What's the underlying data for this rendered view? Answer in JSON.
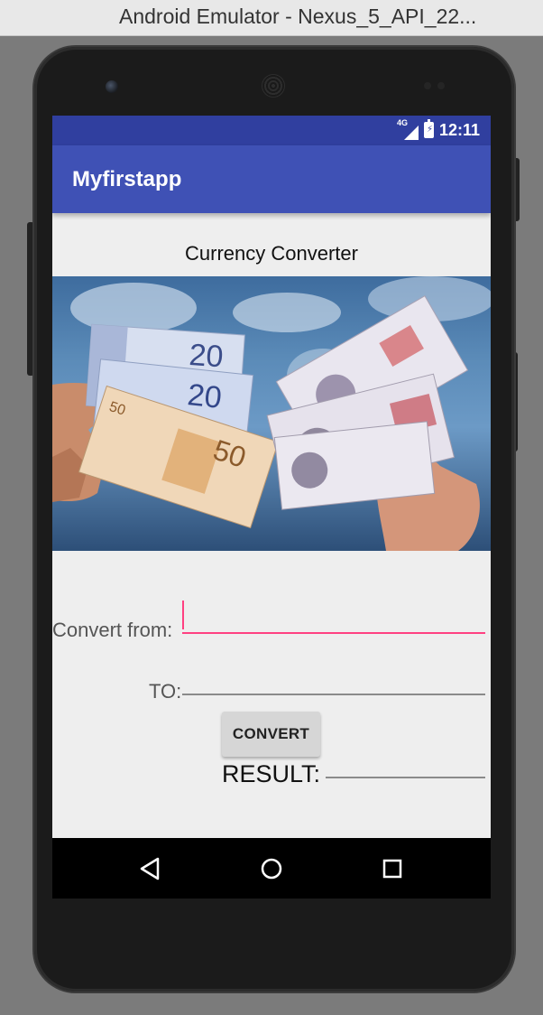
{
  "window": {
    "title": "Android Emulator - Nexus_5_API_22..."
  },
  "status_bar": {
    "network": "4G",
    "time": "12:11"
  },
  "app_bar": {
    "title": "Myfirstapp"
  },
  "main": {
    "heading": "Currency Converter",
    "convert_from_label": "Convert from:",
    "convert_from_value": "",
    "to_label": "TO:",
    "to_value": "",
    "convert_button": "CONVERT",
    "result_label": "RESULT:",
    "result_value": ""
  },
  "nav_bar": {
    "icons": [
      "back-icon",
      "home-icon",
      "recents-icon"
    ]
  },
  "colors": {
    "status_bar": "#303f9f",
    "app_bar": "#3f51b5",
    "accent": "#ff4081",
    "background": "#eeeeee"
  }
}
